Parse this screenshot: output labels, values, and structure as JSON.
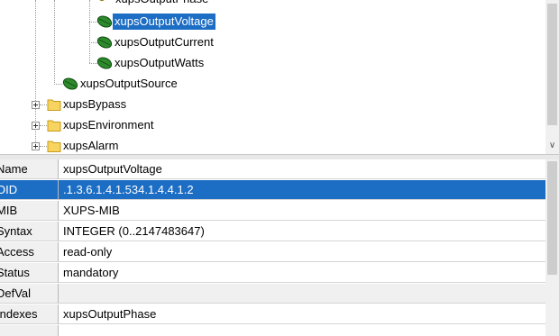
{
  "tree": {
    "partial_top_label": "xupsOutputPhase",
    "items": [
      {
        "label": "xupsOutputVoltage",
        "selected": true
      },
      {
        "label": "xupsOutputCurrent",
        "selected": false
      },
      {
        "label": "xupsOutputWatts",
        "selected": false
      },
      {
        "label": "xupsOutputSource",
        "selected": false
      }
    ],
    "folders": [
      {
        "label": "xupsBypass"
      },
      {
        "label": "xupsEnvironment"
      },
      {
        "label": "xupsAlarm"
      }
    ]
  },
  "properties": {
    "rows": [
      {
        "name": "Name",
        "value": "xupsOutputVoltage",
        "selected": false
      },
      {
        "name": "OID",
        "value": ".1.3.6.1.4.1.534.1.4.4.1.2",
        "selected": true
      },
      {
        "name": "MIB",
        "value": "XUPS-MIB",
        "selected": false
      },
      {
        "name": "Syntax",
        "value": "INTEGER (0..2147483647)",
        "selected": false
      },
      {
        "name": "Access",
        "value": "read-only",
        "selected": false
      },
      {
        "name": "Status",
        "value": "mandatory",
        "selected": false
      },
      {
        "name": "DefVal",
        "value": "",
        "selected": false
      },
      {
        "name": "Indexes",
        "value": "xupsOutputPhase",
        "selected": false
      }
    ]
  },
  "colors": {
    "selection": "#1c6dc4",
    "leaf_green": "#1f7a1f",
    "folder_yellow": "#f5c542"
  }
}
